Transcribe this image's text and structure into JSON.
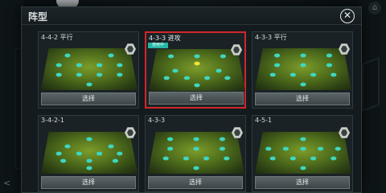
{
  "modal": {
    "title": "阵型"
  },
  "formations": [
    {
      "name": "4-4-2 平行",
      "select_label": "选择",
      "in_use": false,
      "rows": [
        2,
        4,
        4,
        1
      ]
    },
    {
      "name": "4-3-3 进攻",
      "select_label": "选择",
      "in_use": true,
      "badge": "使用中",
      "rows": [
        3,
        1,
        2,
        4,
        1
      ]
    },
    {
      "name": "4-3-3 平行",
      "select_label": "选择",
      "in_use": false,
      "rows": [
        3,
        3,
        4,
        1
      ]
    },
    {
      "name": "3-4-2-1",
      "select_label": "选择",
      "in_use": false,
      "rows": [
        1,
        2,
        4,
        3,
        1
      ]
    },
    {
      "name": "4-3-3",
      "select_label": "选择",
      "in_use": false,
      "rows": [
        3,
        3,
        4,
        1
      ]
    },
    {
      "name": "4-5-1",
      "select_label": "选择",
      "in_use": false,
      "rows": [
        1,
        5,
        4,
        1
      ]
    }
  ],
  "colors": {
    "player_dot": "#3fd6c0",
    "highlight_border": "#d2262b",
    "captain_dot": "#f2e23a"
  },
  "icons": {
    "close": "close-icon",
    "tactic": "tactic-hex-icon",
    "home": "home-icon",
    "share": "share-icon"
  }
}
